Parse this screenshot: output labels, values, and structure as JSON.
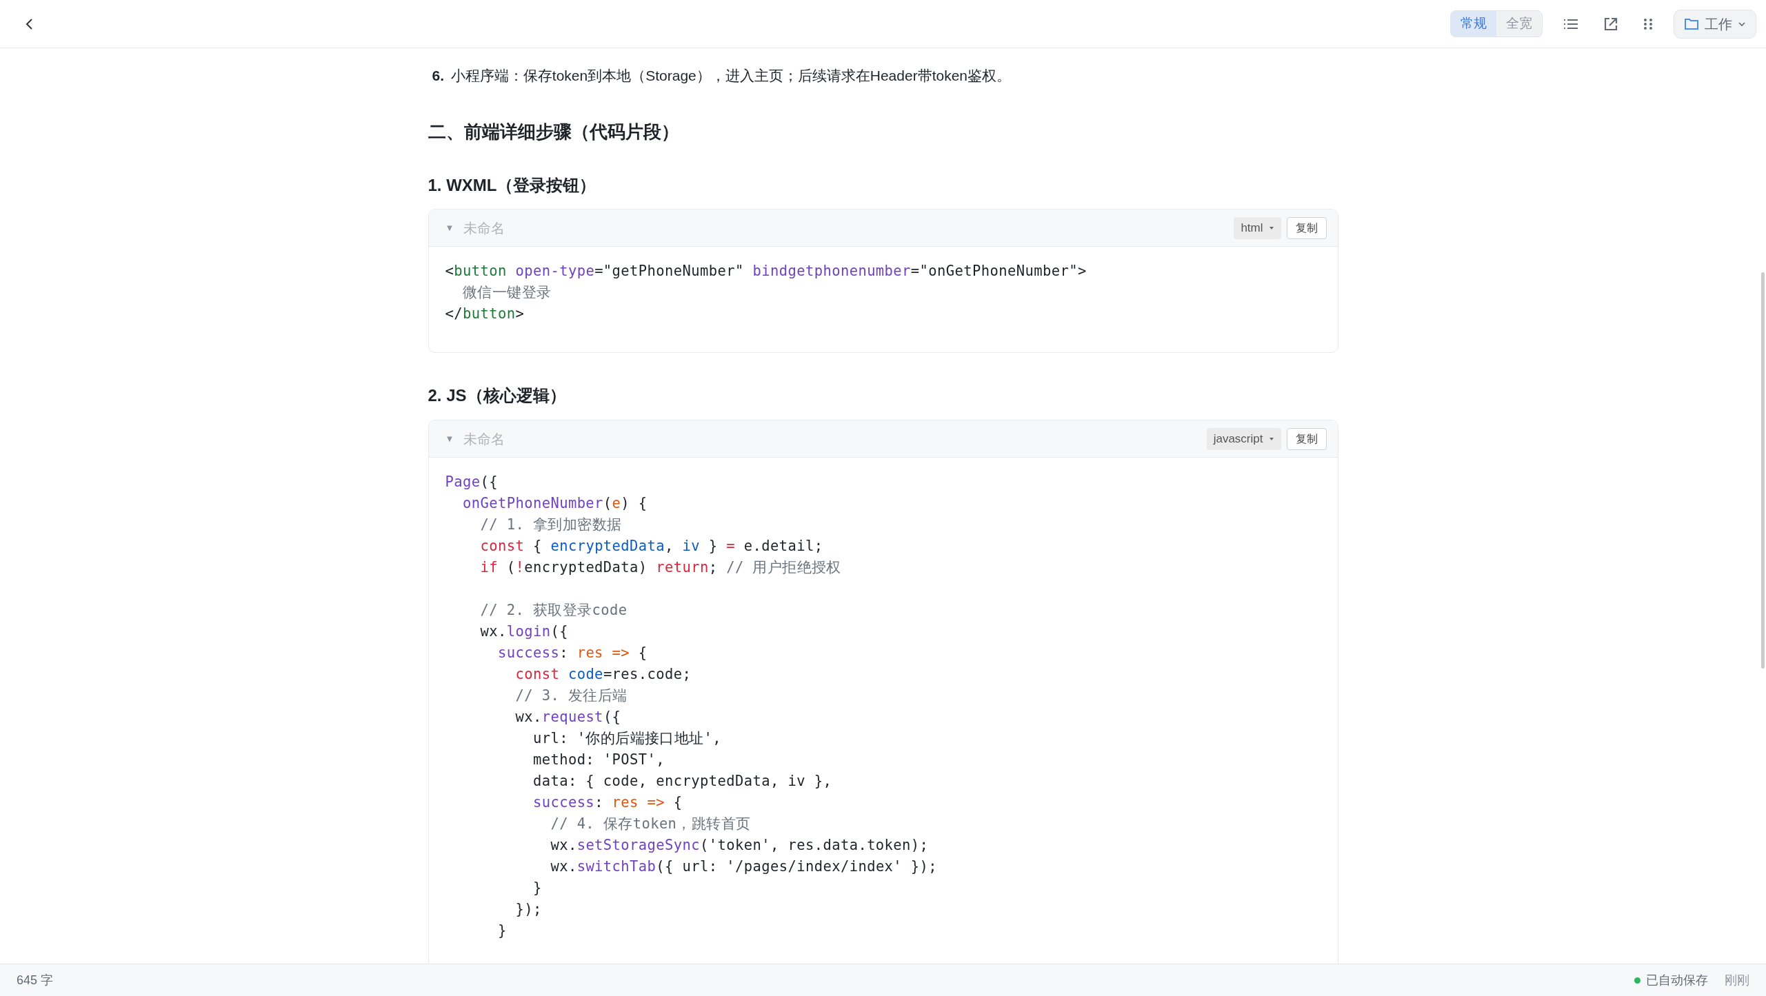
{
  "toolbar": {
    "width_modes": [
      {
        "label": "常规",
        "selected": true
      },
      {
        "label": "全宽",
        "selected": false
      }
    ],
    "folder_button": "工作"
  },
  "list_item": {
    "number": "6.",
    "text": "小程序端：保存token到本地（Storage），进入主页；后续请求在Header带token鉴权。"
  },
  "heading": "二、前端详细步骤（代码片段）",
  "sections": [
    {
      "title": "1. WXML（登录按钮）",
      "block": {
        "toggle": "▼",
        "name": "未命名",
        "language": "html",
        "copy": "复制",
        "lines": [
          {
            "kind": "code",
            "tokens": [
              {
                "kind": "plain",
                "text": "<"
              },
              {
                "kind": "tag",
                "text": "button"
              },
              {
                "kind": "attr",
                "text": " open-type"
              },
              {
                "kind": "plain",
                "text": "=\"getPhoneNumber\" "
              },
              {
                "kind": "attr",
                "text": "bindgetphonenumber"
              },
              {
                "kind": "plain",
                "text": "=\"onGetPhoneNumber\">"
              }
            ]
          },
          {
            "kind": "code",
            "tokens": [
              {
                "kind": "text",
                "text": "  微信一键登录"
              }
            ]
          },
          {
            "kind": "code",
            "tokens": [
              {
                "kind": "plain",
                "text": "</"
              },
              {
                "kind": "tag",
                "text": "button"
              },
              {
                "kind": "plain",
                "text": ">"
              }
            ]
          }
        ]
      }
    },
    {
      "title": "2. JS（核心逻辑）",
      "block": {
        "toggle": "▼",
        "name": "未命名",
        "language": "javascript",
        "copy": "复制",
        "lines": [
          {
            "kind": "code",
            "tokens": [
              {
                "kind": "fn",
                "text": "Page"
              },
              {
                "kind": "plain",
                "text": "({"
              }
            ]
          },
          {
            "kind": "code",
            "tokens": [
              {
                "kind": "fn",
                "text": "  onGetPhoneNumber"
              },
              {
                "kind": "plain",
                "text": "("
              },
              {
                "kind": "param",
                "text": "e"
              },
              {
                "kind": "plain",
                "text": ") {"
              }
            ]
          },
          {
            "kind": "code",
            "tokens": [
              {
                "kind": "comment",
                "text": "    // 1. 拿到加密数据"
              }
            ]
          },
          {
            "kind": "code",
            "tokens": [
              {
                "kind": "kw",
                "text": "    const"
              },
              {
                "kind": "plain",
                "text": " { "
              },
              {
                "kind": "var",
                "text": "encryptedData"
              },
              {
                "kind": "plain",
                "text": ", "
              },
              {
                "kind": "var",
                "text": "iv"
              },
              {
                "kind": "plain",
                "text": " } "
              },
              {
                "kind": "kw",
                "text": "="
              },
              {
                "kind": "plain",
                "text": " e.detail;"
              }
            ]
          },
          {
            "kind": "code",
            "tokens": [
              {
                "kind": "kw",
                "text": "    if"
              },
              {
                "kind": "plain",
                "text": " ("
              },
              {
                "kind": "kw",
                "text": "!"
              },
              {
                "kind": "plain",
                "text": "encryptedData) "
              },
              {
                "kind": "kw",
                "text": "return"
              },
              {
                "kind": "plain",
                "text": "; "
              },
              {
                "kind": "comment",
                "text": "// 用户拒绝授权"
              }
            ]
          },
          {
            "kind": "blank"
          },
          {
            "kind": "code",
            "tokens": [
              {
                "kind": "comment",
                "text": "    // 2. 获取登录code"
              }
            ]
          },
          {
            "kind": "code",
            "tokens": [
              {
                "kind": "plain",
                "text": "    wx."
              },
              {
                "kind": "fn",
                "text": "login"
              },
              {
                "kind": "plain",
                "text": "({"
              }
            ]
          },
          {
            "kind": "code",
            "tokens": [
              {
                "kind": "fn",
                "text": "      success"
              },
              {
                "kind": "plain",
                "text": ": "
              },
              {
                "kind": "param",
                "text": "res =>"
              },
              {
                "kind": "plain",
                "text": " {"
              }
            ]
          },
          {
            "kind": "code",
            "tokens": [
              {
                "kind": "kw",
                "text": "        const"
              },
              {
                "kind": "var",
                "text": " code"
              },
              {
                "kind": "plain",
                "text": "=res.code;"
              }
            ]
          },
          {
            "kind": "code",
            "tokens": [
              {
                "kind": "comment",
                "text": "        // 3. 发往后端"
              }
            ]
          },
          {
            "kind": "code",
            "tokens": [
              {
                "kind": "plain",
                "text": "        wx."
              },
              {
                "kind": "fn",
                "text": "request"
              },
              {
                "kind": "plain",
                "text": "({"
              }
            ]
          },
          {
            "kind": "code",
            "tokens": [
              {
                "kind": "plain",
                "text": "          url: '你的后端接口地址',"
              }
            ]
          },
          {
            "kind": "code",
            "tokens": [
              {
                "kind": "plain",
                "text": "          method: 'POST',"
              }
            ]
          },
          {
            "kind": "code",
            "tokens": [
              {
                "kind": "plain",
                "text": "          data: { code, encryptedData, iv },"
              }
            ]
          },
          {
            "kind": "code",
            "tokens": [
              {
                "kind": "fn",
                "text": "          success"
              },
              {
                "kind": "plain",
                "text": ": "
              },
              {
                "kind": "param",
                "text": "res =>"
              },
              {
                "kind": "plain",
                "text": " {"
              }
            ]
          },
          {
            "kind": "code",
            "tokens": [
              {
                "kind": "comment",
                "text": "            // 4. 保存token，跳转首页"
              }
            ]
          },
          {
            "kind": "code",
            "tokens": [
              {
                "kind": "plain",
                "text": "            wx."
              },
              {
                "kind": "fn",
                "text": "setStorageSync"
              },
              {
                "kind": "plain",
                "text": "('token', res.data.token);"
              }
            ]
          },
          {
            "kind": "code",
            "tokens": [
              {
                "kind": "plain",
                "text": "            wx."
              },
              {
                "kind": "fn",
                "text": "switchTab"
              },
              {
                "kind": "plain",
                "text": "({ url: '/pages/index/index' });"
              }
            ]
          },
          {
            "kind": "code",
            "tokens": [
              {
                "kind": "plain",
                "text": "          }"
              }
            ]
          },
          {
            "kind": "code",
            "tokens": [
              {
                "kind": "plain",
                "text": "        });"
              }
            ]
          },
          {
            "kind": "code",
            "tokens": [
              {
                "kind": "plain",
                "text": "      }"
              }
            ]
          }
        ]
      }
    }
  ],
  "status_bar": {
    "word_count": "645 字",
    "save_status": "已自动保存",
    "save_time": "刚刚"
  }
}
